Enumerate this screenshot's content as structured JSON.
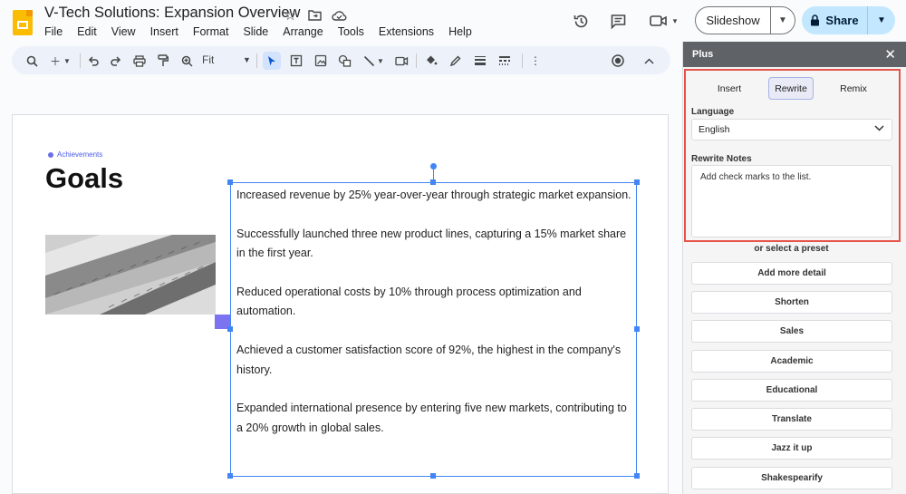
{
  "doc": {
    "title": "V-Tech Solutions: Expansion Overview"
  },
  "menu": [
    "File",
    "Edit",
    "View",
    "Insert",
    "Format",
    "Slide",
    "Arrange",
    "Tools",
    "Extensions",
    "Help"
  ],
  "header": {
    "slideshow_label": "Slideshow",
    "share_label": "Share"
  },
  "toolbar": {
    "zoom_label": "Fit"
  },
  "slide": {
    "section_tag": "Achievements",
    "title": "Goals",
    "body_paragraphs": [
      "Increased revenue by 25% year-over-year through strategic market expansion.",
      "Successfully launched three new product lines, capturing a 15% market share in the first year.",
      "Reduced operational costs by 10% through process optimization and automation.",
      "Achieved a customer satisfaction score of 92%, the highest in the company's history.",
      "Expanded international presence by entering five new markets, contributing to a 20% growth in global sales."
    ]
  },
  "panel": {
    "title": "Plus",
    "tabs": [
      "Insert",
      "Rewrite",
      "Remix"
    ],
    "selected_tab": "Rewrite",
    "language_label": "Language",
    "language_value": "English",
    "notes_label": "Rewrite Notes",
    "notes_value": "Add check marks to the list.",
    "preset_label": "or select a preset",
    "presets": [
      "Add more detail",
      "Shorten",
      "Sales",
      "Academic",
      "Educational",
      "Translate",
      "Jazz it up",
      "Shakespearify"
    ]
  },
  "colors": {
    "accent_blue": "#4285f4",
    "share_bg": "#c2e7ff",
    "highlight_red": "#e5534b",
    "brand_yellow": "#fbbc04"
  }
}
